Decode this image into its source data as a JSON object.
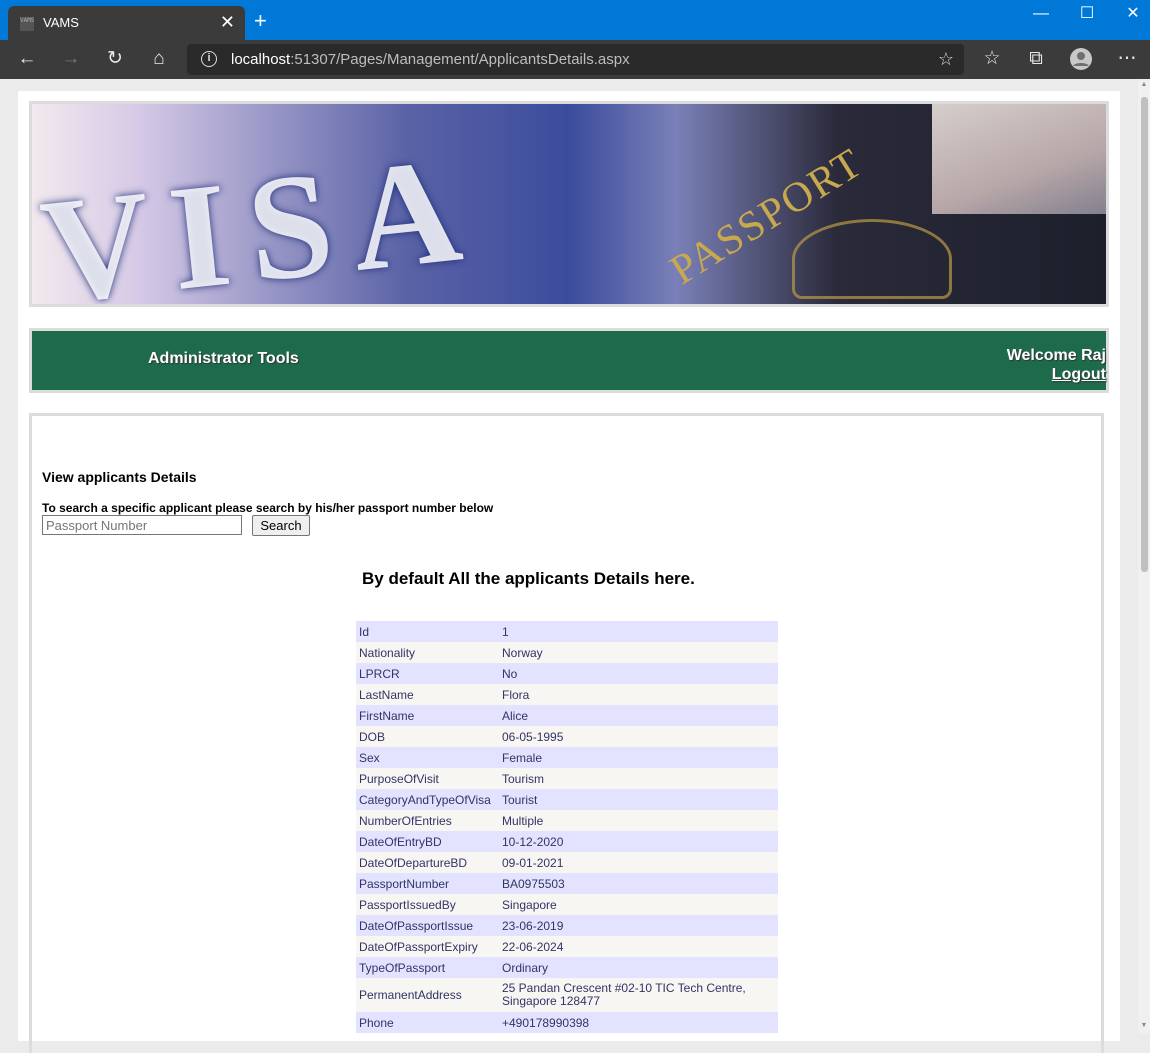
{
  "browser": {
    "tab_title": "VAMS",
    "favicon_text": "VAMS",
    "url_host": "localhost",
    "url_rest": ":51307/Pages/Management/ApplicantsDetails.aspx"
  },
  "header": {
    "menu_title": "Administrator Tools",
    "welcome": "Welcome Raj",
    "logout": "Logout"
  },
  "banner": {
    "visa_text": "VISA",
    "passport_text": "PASSPORT"
  },
  "main": {
    "view_title": "View applicants Details",
    "search_hint": "To search a specific applicant please search by his/her passport number below",
    "search_placeholder": "Passport Number",
    "search_button": "Search",
    "default_message": "By default All the applicants Details here."
  },
  "details": [
    {
      "key": "Id",
      "value": "1"
    },
    {
      "key": "Nationality",
      "value": "Norway"
    },
    {
      "key": "LPRCR",
      "value": "No"
    },
    {
      "key": "LastName",
      "value": "Flora"
    },
    {
      "key": "FirstName",
      "value": "Alice"
    },
    {
      "key": "DOB",
      "value": "06-05-1995"
    },
    {
      "key": "Sex",
      "value": "Female"
    },
    {
      "key": "PurposeOfVisit",
      "value": "Tourism"
    },
    {
      "key": "CategoryAndTypeOfVisa",
      "value": "Tourist"
    },
    {
      "key": "NumberOfEntries",
      "value": "Multiple"
    },
    {
      "key": "DateOfEntryBD",
      "value": "10-12-2020"
    },
    {
      "key": "DateOfDepartureBD",
      "value": "09-01-2021"
    },
    {
      "key": "PassportNumber",
      "value": "BA0975503"
    },
    {
      "key": "PassportIssuedBy",
      "value": "Singapore"
    },
    {
      "key": "DateOfPassportIssue",
      "value": "23-06-2019"
    },
    {
      "key": "DateOfPassportExpiry",
      "value": "22-06-2024"
    },
    {
      "key": "TypeOfPassport",
      "value": "Ordinary"
    },
    {
      "key": "PermanentAddress",
      "value": "25 Pandan Crescent #02-10 TIC Tech Centre, Singapore 128477"
    },
    {
      "key": "Phone",
      "value": "+490178990398"
    }
  ],
  "colors": {
    "menubar": "#1e6b4c",
    "table_odd": "#e3e3ff",
    "table_even": "#f7f6f3",
    "table_text": "#333366",
    "titlebar": "#0078d7"
  }
}
